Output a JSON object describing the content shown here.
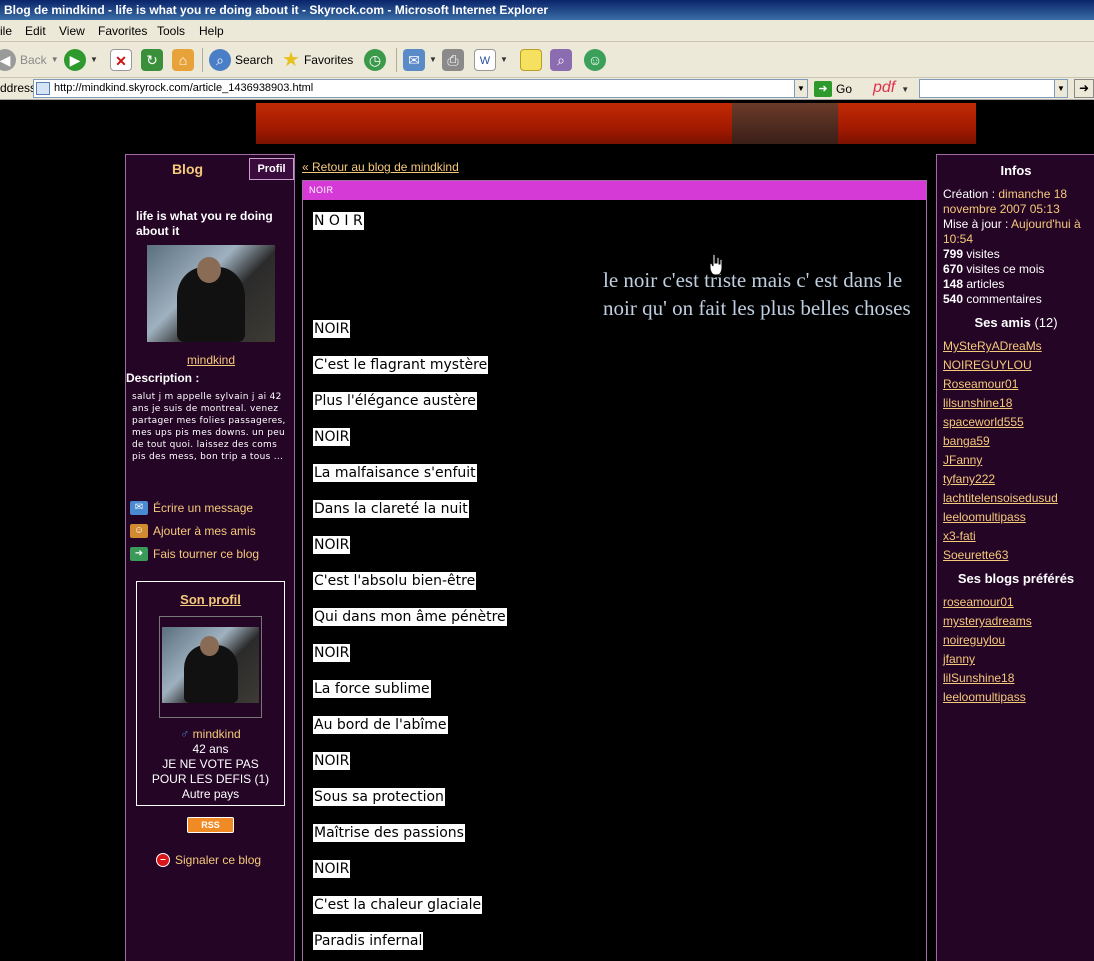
{
  "window": {
    "title": "Blog de mindkind - life is what you re doing about it - Skyrock.com - Microsoft Internet Explorer",
    "menu": [
      "ile",
      "Edit",
      "View",
      "Favorites",
      "Tools",
      "Help"
    ],
    "toolbar": {
      "back": "Back",
      "search": "Search",
      "favorites": "Favorites"
    },
    "address_label": "ddress",
    "url": "http://mindkind.skyrock.com/article_1436938903.html",
    "go": "Go",
    "pdf": "pdf"
  },
  "left": {
    "tab_blog": "Blog",
    "tab_profil": "Profil",
    "blog_title": "life is what you re doing about it",
    "author": "mindkind",
    "description_label": "Description :",
    "description": "salut j m appelle sylvain j ai 42 ans je suis de montreal. venez partager mes folies passageres, mes ups pis mes downs. un peu de tout quoi. laissez des coms pis des mess, bon trip a tous ...",
    "actions": [
      "Écrire un message",
      "Ajouter à mes amis",
      "Fais tourner ce blog"
    ],
    "son_profil": "Son profil",
    "profile_name": "mindkind",
    "age": "42 ans",
    "line1": "JE NE VOTE PAS",
    "line2": "POUR LES DEFIS (1)",
    "country": "Autre pays",
    "rss": "RSS",
    "report": "Signaler ce blog"
  },
  "article": {
    "back_link": "« Retour au blog de mindkind",
    "header": "NOIR",
    "title": "N O I R",
    "quote": "le noir c'est triste mais c' est dans le noir qu' on fait les plus belles choses",
    "lines": [
      "NOIR",
      "C'est le flagrant mystère",
      "Plus l'élégance austère",
      "NOIR",
      "La malfaisance s'enfuit",
      "Dans la clareté la nuit",
      "NOIR",
      "C'est l'absolu bien-être",
      "Qui dans mon âme pénètre",
      "NOIR",
      "La force sublime",
      "Au bord de l'abîme",
      "NOIR",
      "Sous sa protection",
      "Maîtrise des passions",
      "NOIR",
      "C'est la chaleur glaciale",
      "Paradis infernal"
    ]
  },
  "right": {
    "infos_title": "Infos",
    "creation_label": "Création :",
    "creation_value": "dimanche 18 novembre 2007 05:13",
    "update_label": "Mise à jour :",
    "update_value": "Aujourd'hui à 10:54",
    "visits": "799",
    "visits_label": "visites",
    "visits_month": "670",
    "visits_month_label": "visites ce mois",
    "articles": "148",
    "articles_label": "articles",
    "comments": "540",
    "comments_label": "commentaires",
    "friends_title": "Ses amis",
    "friends_count": "(12)",
    "friends": [
      "MySteRyADreaMs",
      "NOIREGUYLOU",
      "Roseamour01",
      "lilsunshine18",
      "spaceworld555",
      "banga59",
      "JFanny",
      "tyfany222",
      "lachtitelensoisedusud",
      "leeloomultipass",
      "x3-fati",
      "Soeurette63"
    ],
    "favorites_title": "Ses blogs préférés",
    "favorites": [
      "roseamour01",
      "mysteryadreams",
      "noireguylou",
      "jfanny",
      "lilSunshine18",
      "leeloomultipass"
    ]
  },
  "colors": {
    "panel_bg": "#240526",
    "link": "#f5c97a",
    "article_header": "#d63ad6"
  }
}
